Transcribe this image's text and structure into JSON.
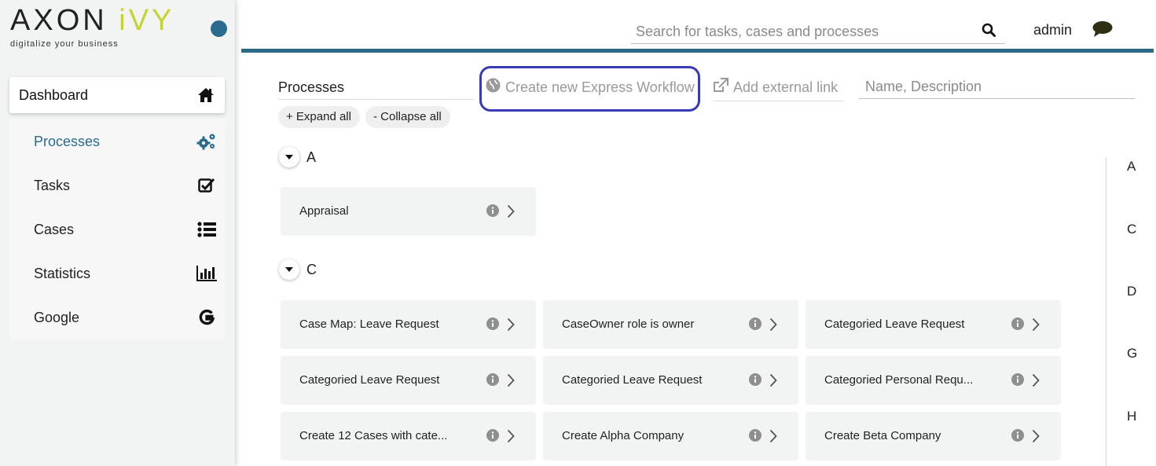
{
  "brand": {
    "name_main": "AXON ",
    "name_accent": "iVY",
    "tagline": "digitalize your business"
  },
  "sidebar": {
    "dashboard_label": "Dashboard",
    "items": [
      {
        "label": "Processes",
        "icon": "gears-icon",
        "active": true
      },
      {
        "label": "Tasks",
        "icon": "checkbox-icon",
        "active": false
      },
      {
        "label": "Cases",
        "icon": "list-icon",
        "active": false
      },
      {
        "label": "Statistics",
        "icon": "bar-chart-icon",
        "active": false
      },
      {
        "label": "Google",
        "icon": "google-g-icon",
        "active": false
      }
    ]
  },
  "header": {
    "search_placeholder": "Search for tasks, cases and processes",
    "user": "admin"
  },
  "toolbar": {
    "title": "Processes",
    "create_express": "Create new Express Workflow",
    "add_external": "Add external link",
    "filter_placeholder": "Name, Description",
    "expand_all": "+ Expand all",
    "collapse_all": "- Collapse all"
  },
  "groups": [
    {
      "letter": "A",
      "processes": [
        "Appraisal"
      ]
    },
    {
      "letter": "C",
      "processes": [
        "Case Map: Leave Request",
        "CaseOwner role is owner",
        "Categoried Leave Request",
        "Categoried Leave Request",
        "Categoried Leave Request",
        "Categoried Personal Requ...",
        "Create 12 Cases with cate...",
        "Create Alpha Company",
        "Create Beta Company"
      ]
    }
  ],
  "index_letters": [
    "A",
    "C",
    "D",
    "G",
    "H"
  ],
  "colors": {
    "accent": "#2a6b8f",
    "brand_accent": "#c5d433",
    "highlight": "#3a3ab8"
  }
}
